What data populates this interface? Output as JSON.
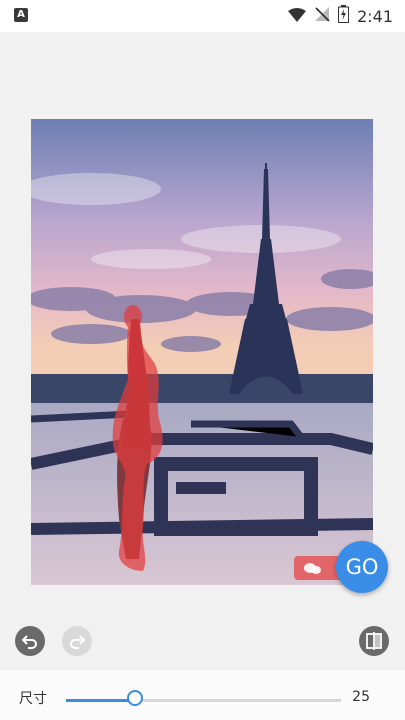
{
  "status_bar": {
    "time": "2:41",
    "notification_icon_letter": "A"
  },
  "editor": {
    "go_button_label": "GO",
    "watermark_badge_icon": "wechat-icon"
  },
  "toolbar": {
    "undo_icon": "undo-icon",
    "redo_icon": "redo-icon",
    "compare_icon": "compare-icon"
  },
  "brush_size": {
    "label": "尺寸",
    "value": "25",
    "slider_fraction": 0.25
  },
  "colors": {
    "accent": "#3a8de6",
    "mask_red": "#e33b3b"
  }
}
